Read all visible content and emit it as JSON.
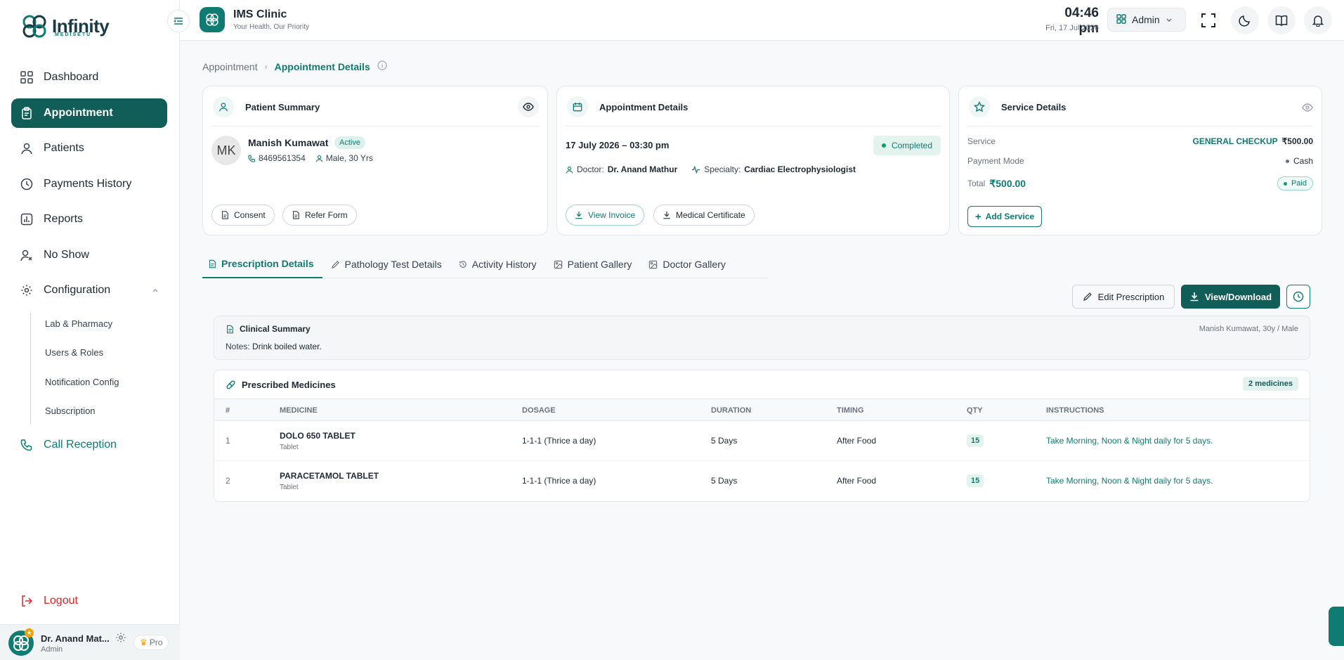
{
  "brand": {
    "name": "Infinity",
    "sub": "MEDISETU"
  },
  "sidebar": {
    "items": [
      {
        "label": "Dashboard"
      },
      {
        "label": "Appointment"
      },
      {
        "label": "Patients"
      },
      {
        "label": "Payments History"
      },
      {
        "label": "Reports"
      },
      {
        "label": "No Show"
      },
      {
        "label": "Configuration"
      }
    ],
    "config_sub": [
      "Lab & Pharmacy",
      "Users & Roles",
      "Notification Config",
      "Subscription"
    ],
    "call_reception": "Call Reception",
    "logout": "Logout"
  },
  "user": {
    "name": "Dr. Anand Mat...",
    "role": "Admin",
    "plan": "Pro"
  },
  "header": {
    "clinic_name": "IMS Clinic",
    "tagline": "Your Health, Our Priority",
    "time": "04:46 pm",
    "date": "Fri, 17 Jul 2026",
    "role_button": "Admin"
  },
  "breadcrumb": {
    "parent": "Appointment",
    "current": "Appointment Details"
  },
  "patient": {
    "card_title": "Patient Summary",
    "initials": "MK",
    "name": "Manish Kumawat",
    "status": "Active",
    "phone": "8469561354",
    "gender_age": "Male, 30 Yrs",
    "buttons": {
      "consent": "Consent",
      "refer": "Refer Form"
    }
  },
  "appointment": {
    "card_title": "Appointment Details",
    "datetime": "17 July 2026 – 03:30 pm",
    "status": "Completed",
    "doctor_label": "Doctor:",
    "doctor": "Dr. Anand Mathur",
    "specialty_label": "Specialty:",
    "specialty": "Cardiac Electrophysiologist",
    "buttons": {
      "invoice": "View Invoice",
      "certificate": "Medical Certificate"
    }
  },
  "service": {
    "card_title": "Service Details",
    "service_label": "Service",
    "service_name": "GENERAL CHECKUP",
    "service_price": "₹500.00",
    "payment_label": "Payment Mode",
    "payment_mode": "Cash",
    "total_label": "Total",
    "total": "₹500.00",
    "paid": "Paid",
    "add_service": "Add Service"
  },
  "tabs": [
    {
      "label": "Prescription Details"
    },
    {
      "label": "Pathology Test Details"
    },
    {
      "label": "Activity History"
    },
    {
      "label": "Patient Gallery"
    },
    {
      "label": "Doctor Gallery"
    }
  ],
  "actions": {
    "edit": "Edit Prescription",
    "view": "View/Download"
  },
  "clinical": {
    "title": "Clinical Summary",
    "patient_line": "Manish Kumawat, 30y / Male",
    "notes_label": "Notes:",
    "notes": "Drink boiled water."
  },
  "medicines": {
    "title": "Prescribed Medicines",
    "count": "2 medicines",
    "columns": [
      "#",
      "MEDICINE",
      "DOSAGE",
      "DURATION",
      "TIMING",
      "QTY",
      "INSTRUCTIONS"
    ],
    "rows": [
      {
        "num": "1",
        "name": "DOLO 650 TABLET",
        "type": "Tablet",
        "dosage": "1-1-1 (Thrice a day)",
        "duration": "5 Days",
        "timing": "After Food",
        "qty": "15",
        "instructions": "Take Morning, Noon & Night daily for 5 days."
      },
      {
        "num": "2",
        "name": "PARACETAMOL TABLET",
        "type": "Tablet",
        "dosage": "1-1-1 (Thrice a day)",
        "duration": "5 Days",
        "timing": "After Food",
        "qty": "15",
        "instructions": "Take Morning, Noon & Night daily for 5 days."
      }
    ]
  },
  "colors": {
    "accent": "#0e7c72",
    "accent_dark": "#115e59",
    "danger": "#dc2626"
  }
}
